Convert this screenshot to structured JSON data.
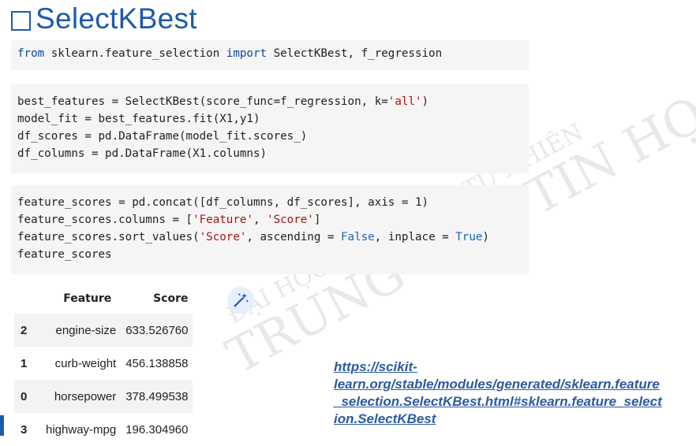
{
  "slide": {
    "title": "SelectKBest"
  },
  "code_cells": [
    {
      "lines": [
        [
          {
            "t": "from",
            "c": "kw"
          },
          {
            "t": " sklearn.feature_selection ",
            "c": ""
          },
          {
            "t": "import",
            "c": "kw"
          },
          {
            "t": " SelectKBest, f_regression",
            "c": ""
          }
        ]
      ]
    },
    {
      "lines": [
        [
          {
            "t": "best_features = SelectKBest(score_func=f_regression, k=",
            "c": ""
          },
          {
            "t": "'all'",
            "c": "str"
          },
          {
            "t": ")",
            "c": ""
          }
        ],
        [
          {
            "t": "model_fit = best_features.fit(X1,y1)",
            "c": ""
          }
        ],
        [
          {
            "t": "df_scores = pd.DataFrame(model_fit.scores_)",
            "c": ""
          }
        ],
        [
          {
            "t": "df_columns = pd.DataFrame(X1.columns)",
            "c": ""
          }
        ]
      ]
    },
    {
      "lines": [
        [
          {
            "t": "feature_scores = pd.concat([df_columns, df_scores], axis = 1)",
            "c": ""
          }
        ],
        [
          {
            "t": "feature_scores.columns = [",
            "c": ""
          },
          {
            "t": "'Feature'",
            "c": "str"
          },
          {
            "t": ", ",
            "c": ""
          },
          {
            "t": "'Score'",
            "c": "str"
          },
          {
            "t": "]",
            "c": ""
          }
        ],
        [
          {
            "t": "feature_scores.sort_values(",
            "c": ""
          },
          {
            "t": "'Score'",
            "c": "str"
          },
          {
            "t": ", ascending = ",
            "c": ""
          },
          {
            "t": "False",
            "c": "bool"
          },
          {
            "t": ", inplace = ",
            "c": ""
          },
          {
            "t": "True",
            "c": "bool"
          },
          {
            "t": ")",
            "c": ""
          }
        ],
        [
          {
            "t": "feature_scores",
            "c": ""
          }
        ]
      ]
    }
  ],
  "dataframe": {
    "columns": [
      "",
      "Feature",
      "Score"
    ],
    "rows": [
      {
        "index": "2",
        "feature": "engine-size",
        "score": "633.526760"
      },
      {
        "index": "1",
        "feature": "curb-weight",
        "score": "456.138858"
      },
      {
        "index": "0",
        "feature": "horsepower",
        "score": "378.499538"
      },
      {
        "index": "3",
        "feature": "highway-mpg",
        "score": "196.304960"
      }
    ]
  },
  "link": {
    "text": "https://scikit-learn.org/stable/modules/generated/sklearn.feature_selection.SelectKBest.html#sklearn.feature_selection.SelectKBest",
    "display_lines": [
      "https://scikit-",
      "learn.org/stable/modules/generated/sklearn.feature",
      "_selection.SelectKBest.html#sklearn.feature_select",
      "ion.SelectKBest"
    ]
  },
  "watermark": {
    "lines": [
      "ĐẠI HỌC KHOA HỌC TỰ NHIÊN",
      "TRUNG TÂM TIN HỌC"
    ]
  },
  "colors": {
    "title": "#1e5aa8",
    "code_bg": "#f5f5f5",
    "link": "#2c5aa0",
    "watermark": "#c8ccd4"
  },
  "icons": {
    "title_bullet": "checkbox-square-icon",
    "magic": "magic-wand-icon"
  }
}
